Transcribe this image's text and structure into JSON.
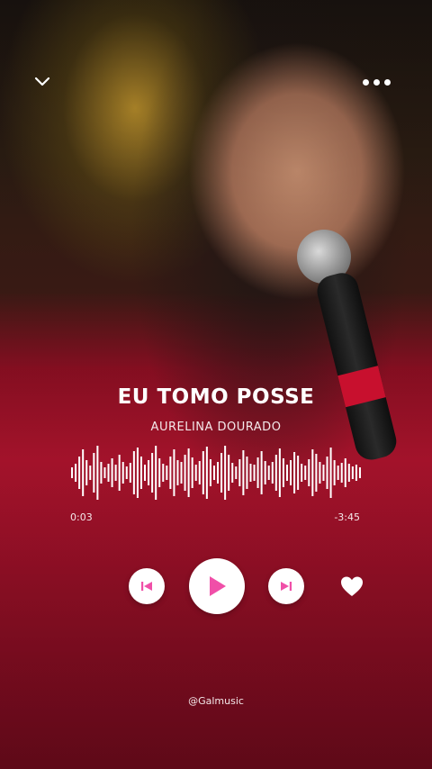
{
  "header": {
    "collapse_icon": "chevron-down-icon",
    "menu_icon": "more-horizontal-icon"
  },
  "track": {
    "title": "EU TOMO POSSE",
    "artist": "AURELINA DOURADO"
  },
  "progress": {
    "elapsed": "0:03",
    "remaining": "-3:45",
    "fraction": 0.013
  },
  "controls": {
    "prev_icon": "skip-previous-icon",
    "play_icon": "play-icon",
    "next_icon": "skip-next-icon",
    "like_icon": "heart-icon",
    "accent_color": "#f04fa8"
  },
  "footer": {
    "handle": "@Galmusic"
  }
}
